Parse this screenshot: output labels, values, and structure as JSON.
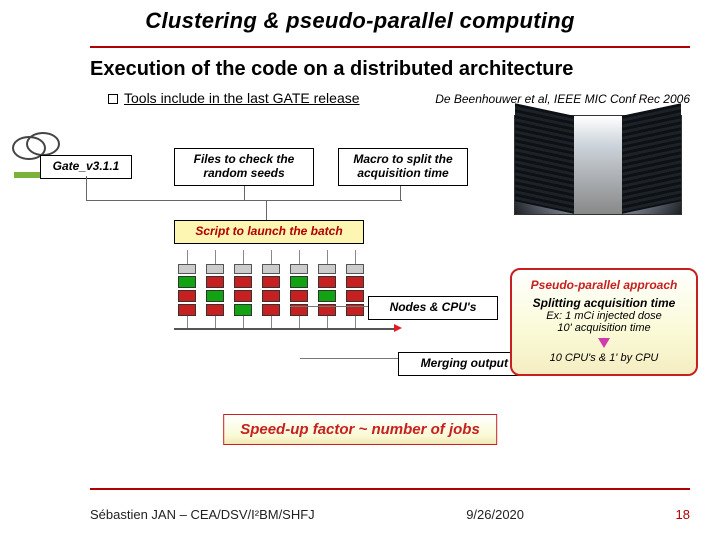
{
  "title": "Clustering & pseudo-parallel computing",
  "subtitle": "Execution of the code on a distributed architecture",
  "bullet": {
    "text": "Tools include in the last GATE release"
  },
  "citation": "De Beenhouwer et al, IEEE MIC Conf Rec 2006",
  "boxes": {
    "gate": "Gate_v3.1.1",
    "files": "Files to check the random seeds",
    "macro": "Macro to split the acquisition time",
    "batch": "Script to launch the batch",
    "nodes": "Nodes & CPU's",
    "merge": "Merging output files"
  },
  "pp": {
    "header": "Pseudo-parallel approach",
    "line1": "Splitting acquisition time",
    "line2": "Ex: 1 mCi injected dose",
    "line3": "10' acquisition time",
    "line4": "10 CPU's & 1' by CPU"
  },
  "speedup": "Speed-up factor ~ number of jobs",
  "footer": {
    "left": "Sébastien JAN – CEA/DSV/I²BM/SHFJ",
    "date": "9/26/2020",
    "page": "18"
  },
  "cpu": {
    "jobs": [
      {
        "cells": [
          "g",
          "r",
          "r"
        ]
      },
      {
        "cells": [
          "r",
          "g",
          "r"
        ]
      },
      {
        "cells": [
          "r",
          "r",
          "g"
        ]
      },
      {
        "cells": [
          "r",
          "r",
          "r"
        ]
      },
      {
        "cells": [
          "g",
          "r",
          "r"
        ]
      },
      {
        "cells": [
          "r",
          "g",
          "r"
        ]
      },
      {
        "cells": [
          "r",
          "r",
          "r"
        ]
      }
    ]
  }
}
